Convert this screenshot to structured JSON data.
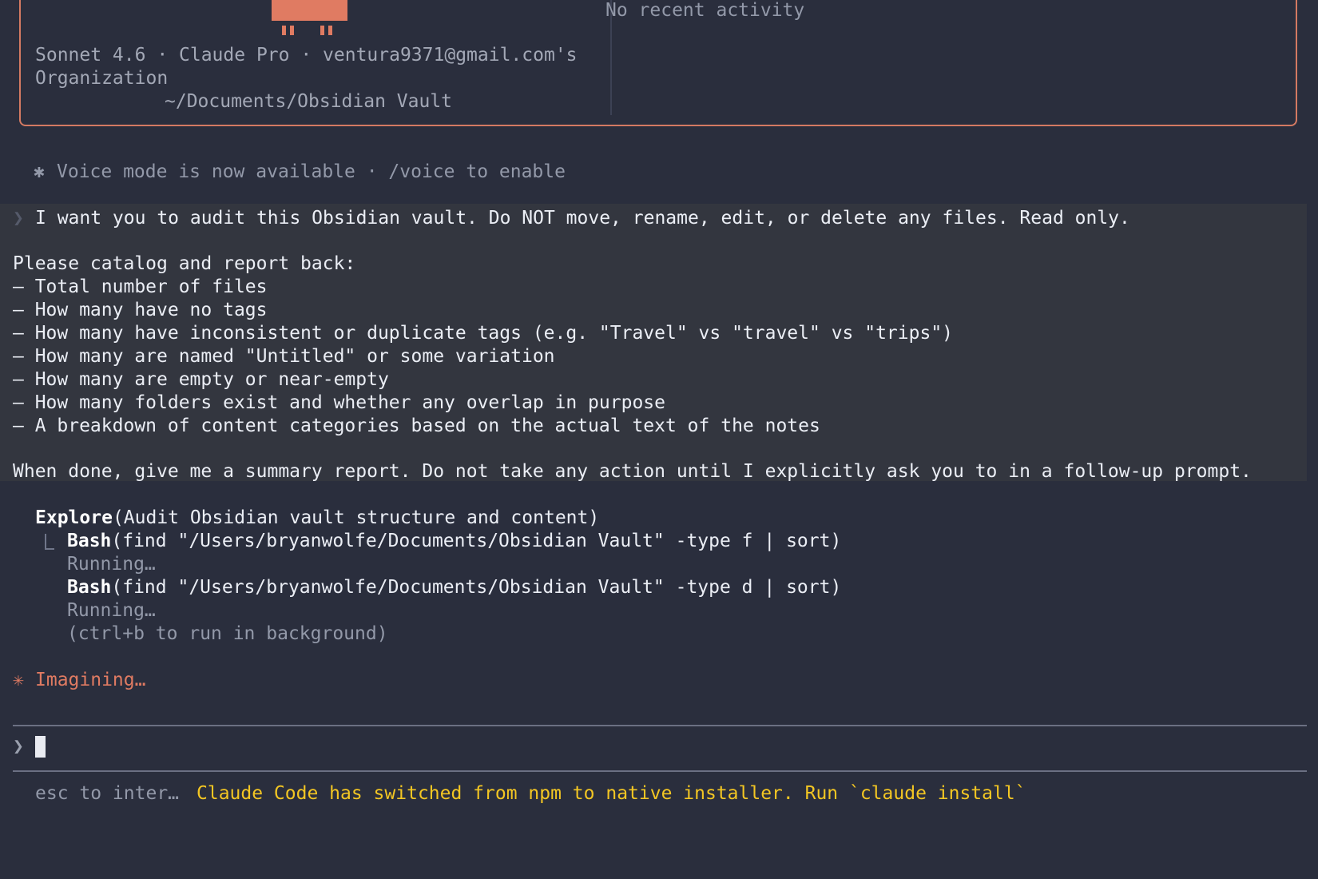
{
  "welcome": {
    "recent_activity": "No recent activity",
    "model_line": "Sonnet 4.6 · Claude Pro · ventura9371@gmail.com's",
    "org_line": "Organization",
    "cwd": "~/Documents/Obsidian Vault"
  },
  "notice": {
    "icon": "✱",
    "text": "Voice mode is now available · /voice to enable"
  },
  "user_prompt": {
    "marker": "❯",
    "lines": [
      "I want you to audit this Obsidian vault. Do NOT move, rename, edit, or delete any files. Read only.",
      "Please catalog and report back:",
      "– Total number of files",
      "– How many have no tags",
      "– How many have inconsistent or duplicate tags (e.g. \"Travel\" vs \"travel\" vs \"trips\")",
      "– How many are named \"Untitled\" or some variation",
      "– How many are empty or near-empty",
      "– How many folders exist and whether any overlap in purpose",
      "– A breakdown of content categories based on the actual text of the notes",
      "When done, give me a summary report. Do not take any action until I explicitly ask you to in a follow-up prompt."
    ]
  },
  "tool_calls": {
    "explore_name": "Explore",
    "explore_args": "(Audit Obsidian vault structure and content)",
    "bash1_name": "Bash",
    "bash1_args": "(find \"/Users/bryanwolfe/Documents/Obsidian Vault\" -type f | sort)",
    "bash1_status": "Running…",
    "bash2_name": "Bash",
    "bash2_args": "(find \"/Users/bryanwolfe/Documents/Obsidian Vault\" -type d | sort)",
    "bash2_status": "Running…",
    "background_hint": "(ctrl+b to run in background)"
  },
  "status": {
    "icon": "✳",
    "text": "Imagining…"
  },
  "input": {
    "prompt_symbol": "❯"
  },
  "footer": {
    "hint": "esc to inter…",
    "message": "Claude Code has switched from npm to native installer. Run `claude install`"
  },
  "colors": {
    "background": "#2a2e3d",
    "accent": "#e07b62",
    "warning": "#f3c623",
    "prompt_bg": "#33363f"
  }
}
